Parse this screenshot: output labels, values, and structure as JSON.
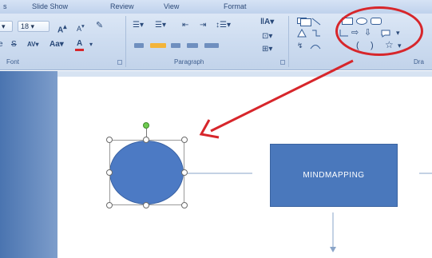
{
  "ribbon": {
    "tabs": [
      "Slide Show",
      "Review",
      "View",
      "Format"
    ],
    "font_group": {
      "label": "Font",
      "size_value": "18",
      "grow_icon": "A",
      "shrink_icon": "A",
      "change_case": "Aa",
      "spacing": "AV",
      "color_icon": "A"
    },
    "paragraph_group": {
      "label": "Paragraph"
    },
    "drawing_group": {
      "label": "Dra"
    }
  },
  "slide": {
    "box_text": "MINDMAPPING"
  },
  "colors": {
    "ribbon_bg": "#cddcf0",
    "shape_fill": "#4a78bc",
    "annotation_red": "#d7262b",
    "rotate_handle": "#6ecb4f"
  },
  "icons": [
    "rotate-handle-icon",
    "shape-gallery-icons",
    "dialog-launcher-icon"
  ]
}
